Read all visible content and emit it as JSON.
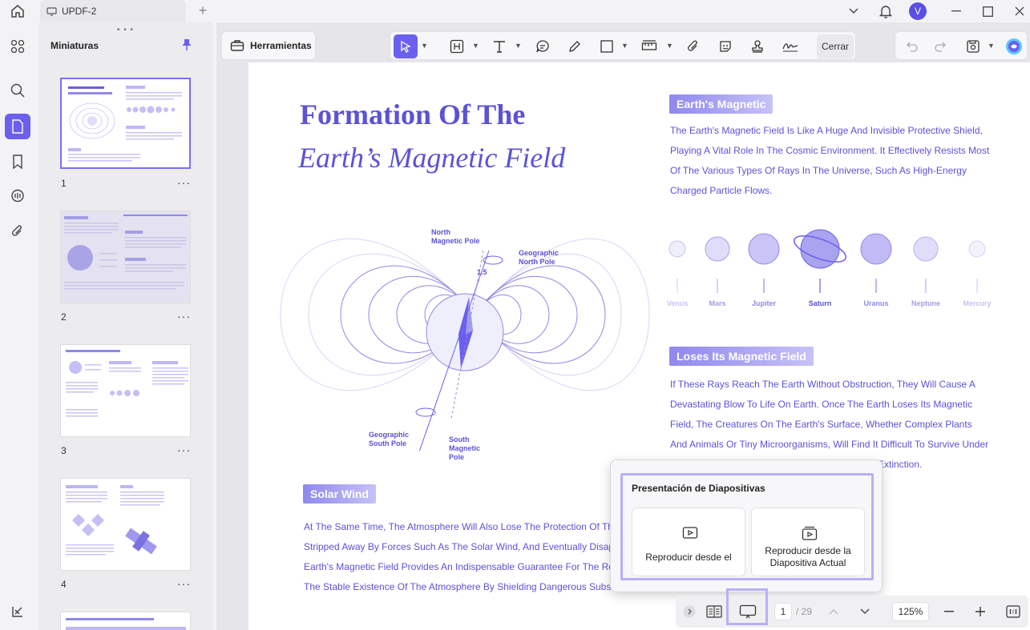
{
  "window": {
    "tab_title": "UPDF-2",
    "new_tab": "+",
    "user_initial": "V"
  },
  "sidebar_panel": {
    "title": "Miniaturas",
    "grip": "• • •",
    "pages": [
      {
        "number": "1",
        "more": "···"
      },
      {
        "number": "2",
        "more": "···"
      },
      {
        "number": "3",
        "more": "···"
      },
      {
        "number": "4",
        "more": "···"
      }
    ]
  },
  "toolbar": {
    "tools_label": "Herramientas",
    "close_label": "Cerrar"
  },
  "document": {
    "title_line1": "Formation Of The",
    "title_line2": "Earth’s Magnetic Field",
    "section1_title": "Earth's Magnetic",
    "section1_text": "The Earth's Magnetic Field Is Like A Huge And Invisible Protective Shield, Playing A Vital Role In The Cosmic Environment. It Effectively Resists Most Of The Various Types Of Rays In The Universe, Such As High-Energy Charged Particle Flows.",
    "planets": [
      "Venus",
      "Mars",
      "Jupiter",
      "Saturn",
      "Uranus",
      "Neptune",
      "Mercury"
    ],
    "section2_title": "Loses Its Magnetic Field",
    "section2_text": "If These Rays Reach The Earth Without Obstruction, They Will Cause A Devastating Blow To Life On Earth. Once The Earth Loses Its Magnetic Field, The Creatures On The Earth's Surface, Whether Complex Plants And Animals Or Tiny Microorganisms, Will Find It Difficult To Survive Under The",
    "section2_tail": "Extinction.",
    "section3_title": "Solar Wind",
    "section3_lines": [
      "At The Same Time, The Atmosphere Will Also Lose The Protection Of The",
      "Stripped Away By Forces Such As The Solar Wind, And Eventually Disapp",
      "Earth's Magnetic Field Provides An Indispensable Guarantee For The Rep",
      "The Stable Existence Of The Atmosphere By Shielding Dangerous Substa"
    ],
    "diagram": {
      "north_magnetic_pole": [
        "North",
        "Magnetic Pole"
      ],
      "geographic_north_pole": [
        "Geographic",
        "North Pole"
      ],
      "geographic_south_pole": [
        "Geographic",
        "South Pole"
      ],
      "south_magnetic_pole": [
        "South",
        "Magnetic",
        "Pole"
      ],
      "angle": "1.5"
    }
  },
  "slideshow_popup": {
    "title": "Presentación de Diapositivas",
    "option1": "Reproducir desde el",
    "option2_line1": "Reproducir desde la",
    "option2_line2": "Diapositiva Actual"
  },
  "bottom_bar": {
    "current_page": "1",
    "total_pages": "/ 29",
    "zoom": "125%"
  },
  "colors": {
    "accent": "#6b5ff0",
    "doc_text": "#5c52d6",
    "highlight_border": "#b7b0f5"
  }
}
